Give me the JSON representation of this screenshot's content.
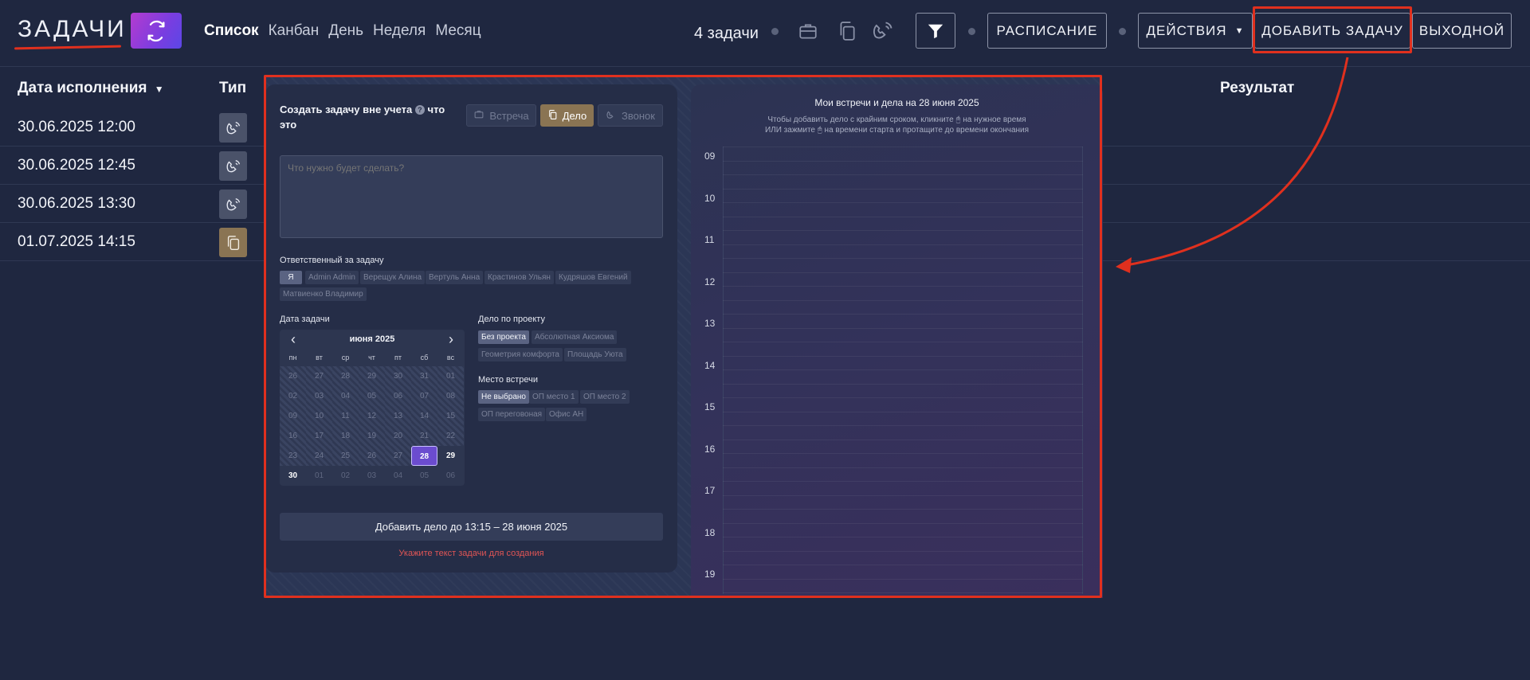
{
  "header": {
    "title": "ЗАДАЧИ",
    "views": [
      "Список",
      "Канбан",
      "День",
      "Неделя",
      "Месяц"
    ],
    "tasks_count": "4 задачи",
    "schedule_label": "РАСПИСАНИЕ",
    "actions_label": "ДЕЙСТВИЯ",
    "add_task_label": "ДОБАВИТЬ ЗАДАЧУ",
    "day_off_label": "ВЫХОДНОЙ"
  },
  "table": {
    "columns": {
      "due": "Дата исполнения",
      "type": "Тип",
      "result": "Результат"
    },
    "rows": [
      {
        "date": "30.06.2025 12:00",
        "type": "phone-icon"
      },
      {
        "date": "30.06.2025 12:45",
        "type": "phone-icon"
      },
      {
        "date": "30.06.2025 13:30",
        "type": "phone-icon"
      },
      {
        "date": "01.07.2025 14:15",
        "type": "document-icon"
      }
    ]
  },
  "form": {
    "title": "Создать задачу вне учета",
    "title_suffix": "что это",
    "types": [
      "Встреча",
      "Дело",
      "Звонок"
    ],
    "active_type": "Дело",
    "task_placeholder": "Что нужно будет сделать?",
    "responsible_label": "Ответственный за задачу",
    "responsible": [
      "Я",
      "Admin Admin",
      "Верещук Алина",
      "Вертуль Анна",
      "Крастинов Ульян",
      "Кудряшов Евгений",
      "Матвиенко Владимир"
    ],
    "date_label": "Дата задачи",
    "calendar": {
      "month": "июня 2025",
      "dow": [
        "пн",
        "вт",
        "ср",
        "чт",
        "пт",
        "сб",
        "вс"
      ],
      "days": [
        "26",
        "27",
        "28",
        "29",
        "30",
        "31",
        "01",
        "02",
        "03",
        "04",
        "05",
        "06",
        "07",
        "08",
        "09",
        "10",
        "11",
        "12",
        "13",
        "14",
        "15",
        "16",
        "17",
        "18",
        "19",
        "20",
        "21",
        "22",
        "23",
        "24",
        "25",
        "26",
        "27",
        "28",
        "29",
        "30",
        "01",
        "02",
        "03",
        "04",
        "05",
        "06"
      ],
      "selected": "28"
    },
    "project_label": "Дело по проекту",
    "projects": [
      "Без проекта",
      "Абсолютная Аксиома",
      "Геометрия комфорта",
      "Площадь Уюта"
    ],
    "place_label": "Место встречи",
    "places": [
      "Не выбрано",
      "ОП место 1",
      "ОП место 2",
      "ОП переговоная",
      "Офис АН"
    ],
    "add_button": "Добавить дело до 13:15 – 28 июня 2025",
    "warning": "Укажите текст задачи для создания"
  },
  "schedule": {
    "title": "Мои встречи и дела на 28 июня 2025",
    "hint_line1": "Чтобы добавить дело с крайним сроком, кликните 🖰 на нужное время",
    "hint_line2": "ИЛИ зажмите 🖰 на времени старта и протащите до времени окончания",
    "hours": [
      "09",
      "10",
      "11",
      "12",
      "13",
      "14",
      "15",
      "16",
      "17",
      "18",
      "19"
    ]
  },
  "colors": {
    "highlight": "#e0301e",
    "accent": "#6b4ccf",
    "doc_type": "#8a7453"
  }
}
